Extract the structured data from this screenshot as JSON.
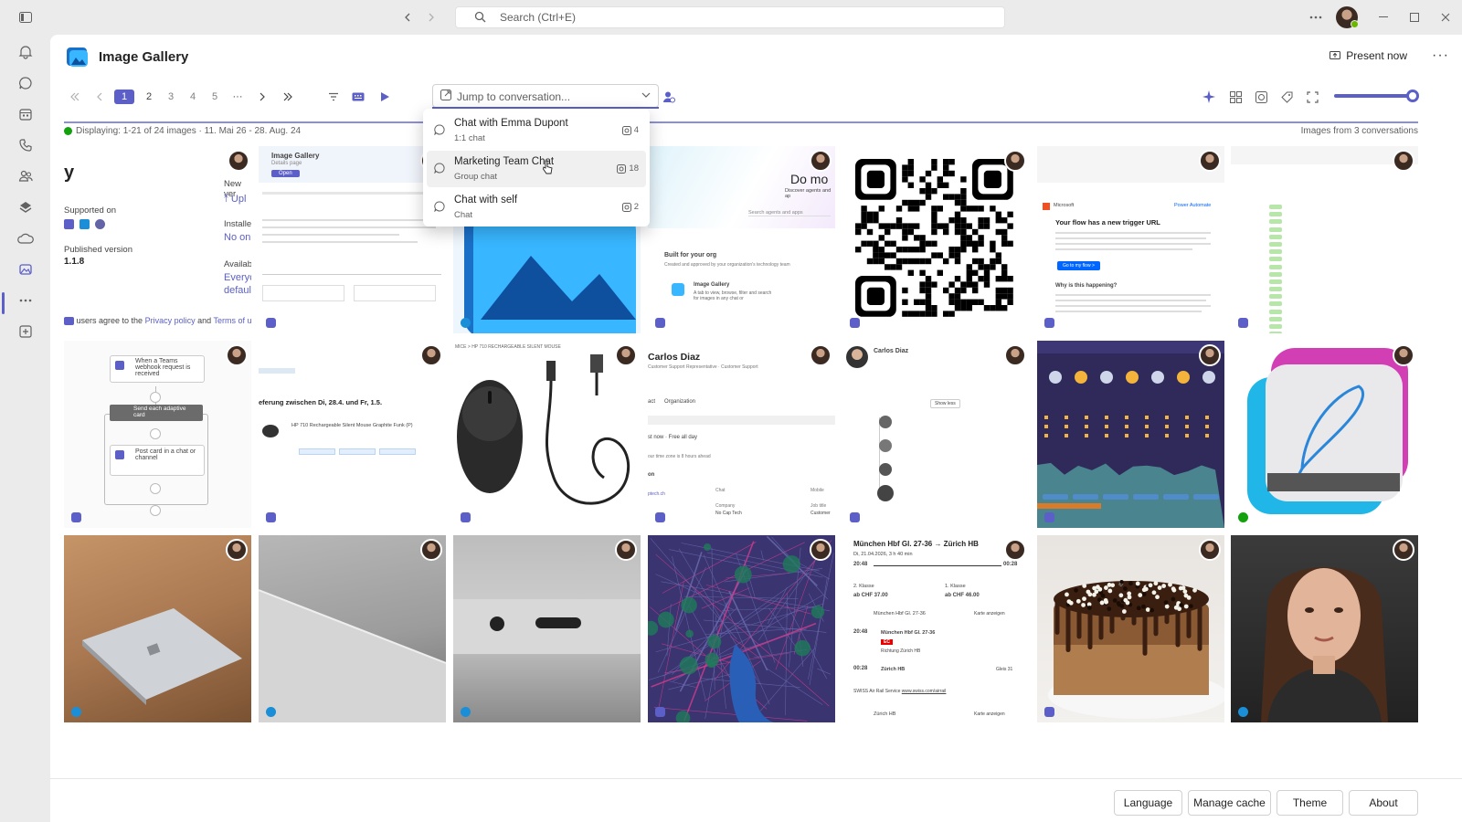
{
  "search": {
    "placeholder": "Search (Ctrl+E)"
  },
  "app": {
    "title": "Image Gallery",
    "present_label": "Present now"
  },
  "pagination": {
    "pages": [
      "1",
      "2",
      "3",
      "4",
      "5"
    ],
    "ellipsis": "···",
    "active": "1"
  },
  "jump": {
    "placeholder": "Jump to conversation..."
  },
  "status": {
    "displaying": "Displaying: 1-21 of 24 images · 11. Mai 26 - 28. Aug. 24",
    "source": "Images from 3 conversations"
  },
  "conversations": [
    {
      "name": "Chat with Emma Dupont",
      "type": "1:1 chat",
      "count": "4"
    },
    {
      "name": "Marketing Team Chat",
      "type": "Group chat",
      "count": "18"
    },
    {
      "name": "Chat with self",
      "type": "Chat",
      "count": "2"
    }
  ],
  "tiles": {
    "t1": {
      "heading": "y",
      "supported": "Supported on",
      "published": "Published version",
      "version": "1.1.8",
      "new": "New ver",
      "upl": "Upl",
      "installed": "Installec",
      "no": "No on",
      "avail": "Availab",
      "every": "Everyo",
      "default": "defaul",
      "agree": "users agree to the",
      "privacy": "Privacy policy",
      "and": "and",
      "terms": "Terms of u"
    },
    "t2": {
      "title": "Image Gallery",
      "sub": "Details page",
      "open": "Open"
    },
    "t4": {
      "do_more": "Do mo",
      "discover": "Discover agents and ap",
      "search": "Search agents and apps",
      "built": "Built for your org",
      "built_sub": "Created and approved by your organization's technology team",
      "app": "Image Gallery",
      "app_sub": "A tab to view, browse, filter and search for images in any chat or"
    },
    "t6": {
      "heading": "Your flow has a new trigger URL",
      "button": "Go to my flow >",
      "why": "Why is this happening?",
      "ms": "Microsoft",
      "pa": "Power Automate"
    },
    "t8": {
      "step1": "When a Teams webhook request is received",
      "step2": "Send each adaptive card",
      "step3": "Post card in a chat or channel"
    },
    "t9": {
      "heading": "eferung zwischen Di, 28.4. und Fr, 1.5.",
      "product": "HP 710 Rechargeable Silent Mouse Graphite Funk (P)"
    },
    "t10": {
      "breadcrumb": "MICE > HP 710 RECHARGEABLE SILENT MOUSE"
    },
    "t11": {
      "name": "Carlos Diaz",
      "role": "Customer Support Representative · Customer Support",
      "tab1": "act",
      "tab2": "Organization",
      "status": "st now · Free all day",
      "tz": "our time zone is 8 hours ahead",
      "on": "on",
      "org": "ptech.ch",
      "chat": "Chat",
      "company": "Company",
      "company_val": "No Cap Tech",
      "mobile": "Mobile",
      "jobtitle": "Job title",
      "job_val": "Customer"
    },
    "t12": {
      "name": "Carlos Diaz",
      "show": "Show less"
    },
    "t17": {
      "route": "München Hbf Gl. 27-36 → Zürich HB",
      "date": "Di, 21.04.2026, 3 h 40 min",
      "dep": "20:48",
      "arr": "00:28",
      "class2": "2. Klasse",
      "price2": "ab CHF 37.00",
      "class1": "1. Klasse",
      "price1": "ab CHF 46.00",
      "from": "München Hbf Gl. 27-36",
      "map": "Karte anzeigen",
      "dep2": "20:48",
      "from2": "München Hbf Gl. 27-36",
      "train": "EC",
      "direction": "Richtung Zürich HB",
      "arr2": "00:28",
      "to": "Zürich HB",
      "platform": "Gleis 31",
      "service": "SWISS Air Rail Service",
      "link": "www.swiss.com/airrail",
      "to2": "Zürich HB",
      "map2": "Karte anzeigen"
    }
  },
  "footer": {
    "language": "Language",
    "cache": "Manage cache",
    "theme": "Theme",
    "about": "About"
  }
}
